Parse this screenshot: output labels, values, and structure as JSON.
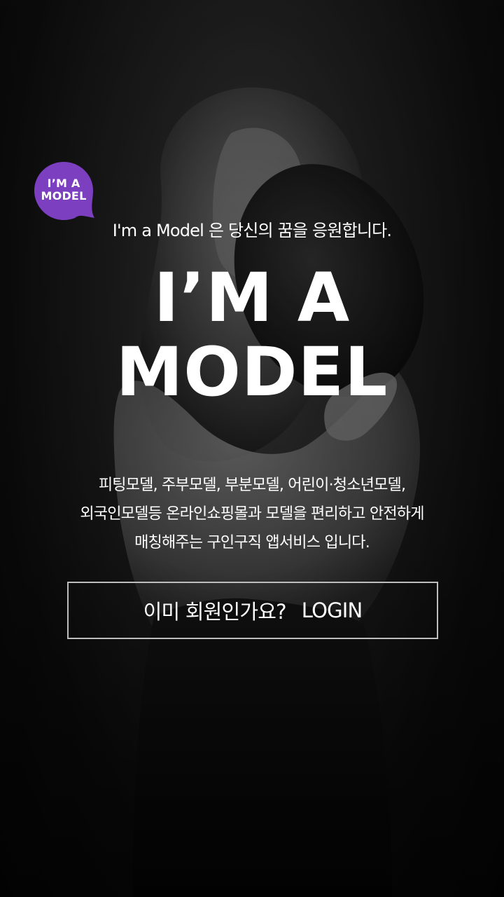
{
  "badge": {
    "line1": "I’M A",
    "line2": "MODEL",
    "color": "#7b3fbf"
  },
  "tagline": "I'm a Model 은 당신의 꿈을 응원합니다.",
  "logo": {
    "line1": "I’M A",
    "line2": "MODEL"
  },
  "description": {
    "line1": "피팅모델, 주부모델, 부분모델, 어린이·청소년모델,",
    "line2": "외국인모델등 온라인쇼핑몰과 모델을 편리하고 안전하게",
    "line3": "매칭해주는 구인구직 앱서비스 입니다."
  },
  "login": {
    "question": "이미 회원인가요?",
    "label": "LOGIN",
    "border_color": "#bdbdbd"
  },
  "background": {
    "image": "black-and-white photo of a woman holding a black hat"
  }
}
